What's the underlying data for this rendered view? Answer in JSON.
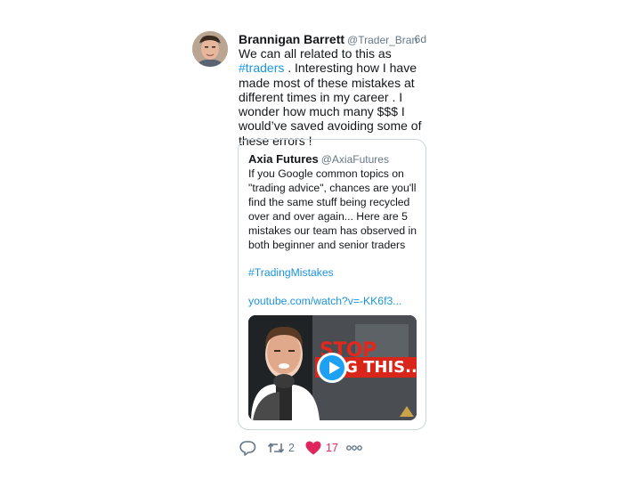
{
  "tweet": {
    "author_name": "Brannigan Barrett",
    "author_handle": "@Trader_Bran",
    "timestamp": "6d",
    "text_before": "We can all related to this as ",
    "hashtag": "#traders",
    "text_after": " . Interesting how I have made most of these mistakes at different times in my career . I wonder how much many $$$ I would’ve saved avoiding some of these errors !"
  },
  "quote": {
    "author_name": "Axia Futures",
    "author_handle": "@AxiaFutures",
    "text": "If you Google common topics on \"trading advice\", chances are you'll find the same stuff being recycled over and over again... Here are 5 mistakes our team has observed in both beginner and senior traders",
    "hashtag": "#TradingMistakes",
    "url": "youtube.com/watch?v=-KK6f3...",
    "media": {
      "headline_top": "STOP",
      "headline_bottom": "NG THIS.."
    }
  },
  "actions": {
    "retweet_count": "2",
    "like_count": "17"
  },
  "colors": {
    "link": "#1b95e0",
    "like": "#e0245e",
    "secondary": "#657786",
    "border": "#ccd6dd"
  },
  "icons": [
    "reply-icon",
    "retweet-icon",
    "heart-icon",
    "more-icon",
    "play-icon"
  ]
}
